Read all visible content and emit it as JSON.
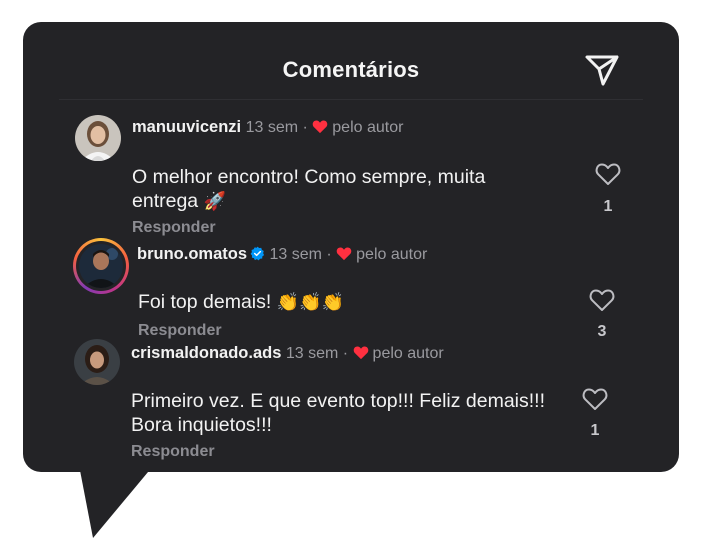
{
  "header": {
    "title": "Comentários"
  },
  "comments": [
    {
      "username": "manuuvicenzi",
      "time": "13 sem",
      "separator": "·",
      "liked_by_author": "pelo autor",
      "text_line1": "O melhor encontro! Como sempre, muita",
      "text_line2": "entrega",
      "emoji": "🚀",
      "reply": "Responder",
      "likes": "1"
    },
    {
      "username": "bruno.omatos",
      "verified": true,
      "time": "13 sem",
      "separator": "·",
      "liked_by_author": "pelo autor",
      "text_line1": "Foi top demais!",
      "emoji": "👏👏👏",
      "reply": "Responder",
      "likes": "3"
    },
    {
      "username": "crismaldonado.ads",
      "time": "13 sem",
      "separator": "·",
      "liked_by_author": "pelo autor",
      "text_line1": "Primeiro vez. E que evento top!!! Feliz demais!!!",
      "text_line2": "Bora inquietos!!!",
      "reply": "Responder",
      "likes": "1"
    }
  ],
  "colors": {
    "panel": "#232326",
    "heart": "#ff3040",
    "verified": "#0095f6"
  }
}
